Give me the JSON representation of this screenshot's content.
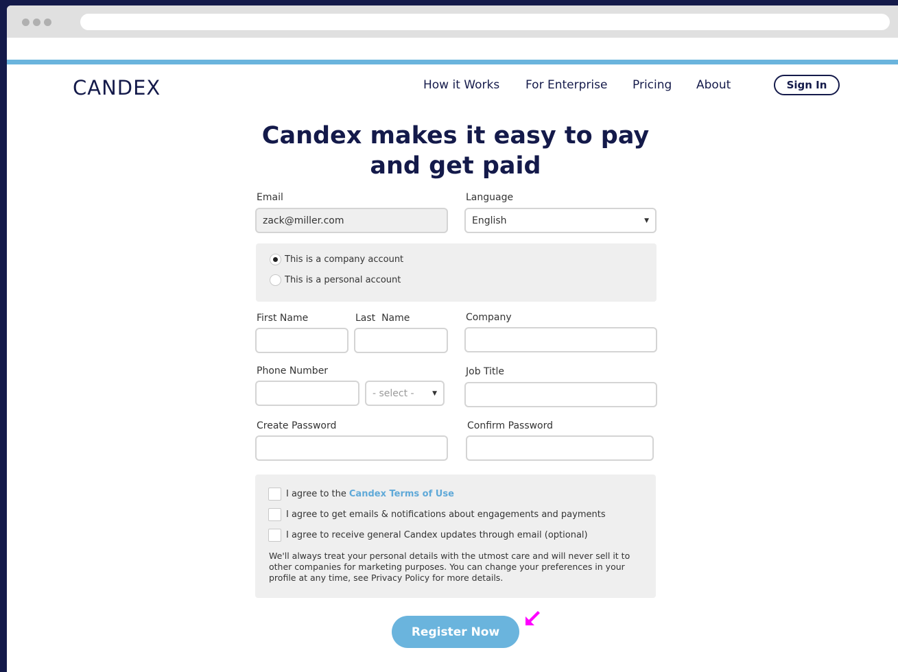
{
  "brand": {
    "logo_text": "CANDEX",
    "accent_color": "#6ab4dd",
    "navy": "#141a4a",
    "pointer_color": "#ff00ff"
  },
  "nav": {
    "links": [
      "How it Works",
      "For Enterprise",
      "Pricing",
      "About"
    ],
    "sign_in": "Sign In"
  },
  "headline": "Candex makes it easy to pay and get paid",
  "form": {
    "email_label": "Email",
    "email_value": "zack@miller.com",
    "language_label": "Language",
    "language_value": "English",
    "account_type": {
      "company": "This is a company account",
      "personal": "This is a personal account",
      "selected": "company"
    },
    "first_name_label": "First Name",
    "last_name_label": "Last  Name",
    "company_label": "Company",
    "phone_label": "Phone Number",
    "phone_select_placeholder": "- select -",
    "job_title_label": "Job Title",
    "create_password_label": "Create Password",
    "confirm_password_label": "Confirm Password"
  },
  "agreements": {
    "terms_prefix": "I agree to the",
    "terms_link": "Candex Terms of Use",
    "emails": "I agree to get emails & notifications about engagements and payments",
    "updates": "I agree to receive general Candex updates through email (optional)",
    "privacy_note": "We'll always treat your personal details with the utmost care and will never sell it to other companies for marketing purposes. You can change your preferences in your profile at any time, see Privacy Policy for more details."
  },
  "register_button": "Register Now",
  "icons": {
    "select_arrow": "caret-down-icon",
    "pointer": "arrow-pointer-icon"
  }
}
